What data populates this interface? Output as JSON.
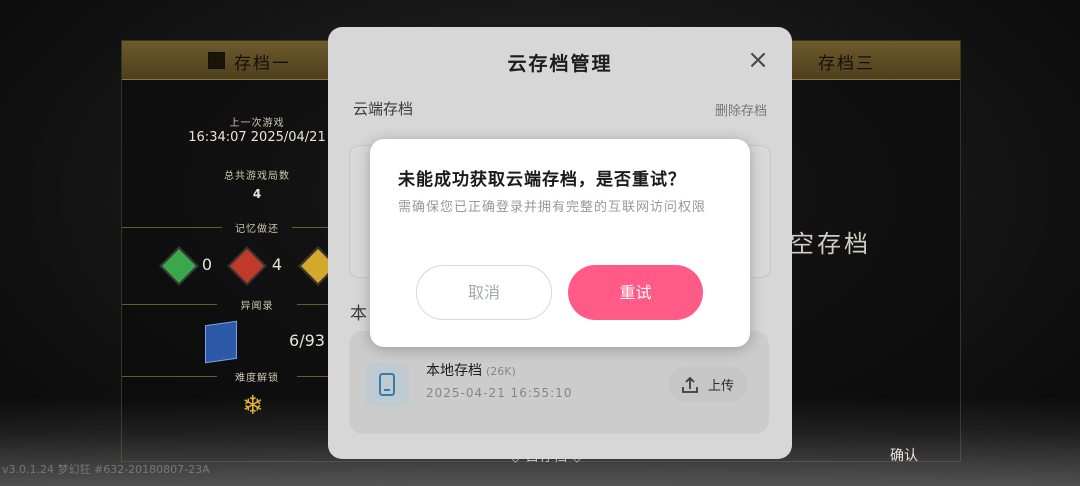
{
  "background_slots": {
    "slot1": {
      "title": "存档一",
      "last_played_label": "上一次游戏",
      "last_played_value": "16:34:07 2025/04/21",
      "total_games_label": "总共游戏局数",
      "total_games_value": "4",
      "memory_label": "记忆做还",
      "gem_counts": [
        "0",
        "4"
      ],
      "records_label": "异闻录",
      "records_value": "6/93",
      "difficulty_label": "难度解锁"
    },
    "slot3": {
      "title": "存档三",
      "empty_label": "空存档"
    },
    "confirm_label": "确认",
    "bottom_label": "◇ 目存档 ◇",
    "version_text": "v3.0.1.24 梦幻狂 #632-20180807-23A"
  },
  "cloud_manager": {
    "title": "云存档管理",
    "cloud_section_label": "云端存档",
    "delete_label": "删除存档",
    "local_section_label": "本",
    "local_save": {
      "name": "本地存档",
      "size": "(26K)",
      "time": "2025-04-21 16:55:10",
      "upload_label": "上传"
    }
  },
  "error_dialog": {
    "title": "未能成功获取云端存档，是否重试？",
    "description": "需确保您已正确登录并拥有完整的互联网访问权限",
    "cancel_label": "取消",
    "retry_label": "重试"
  },
  "colors": {
    "accent": "#ff5a88",
    "slot_header": "#6e5a2c"
  }
}
